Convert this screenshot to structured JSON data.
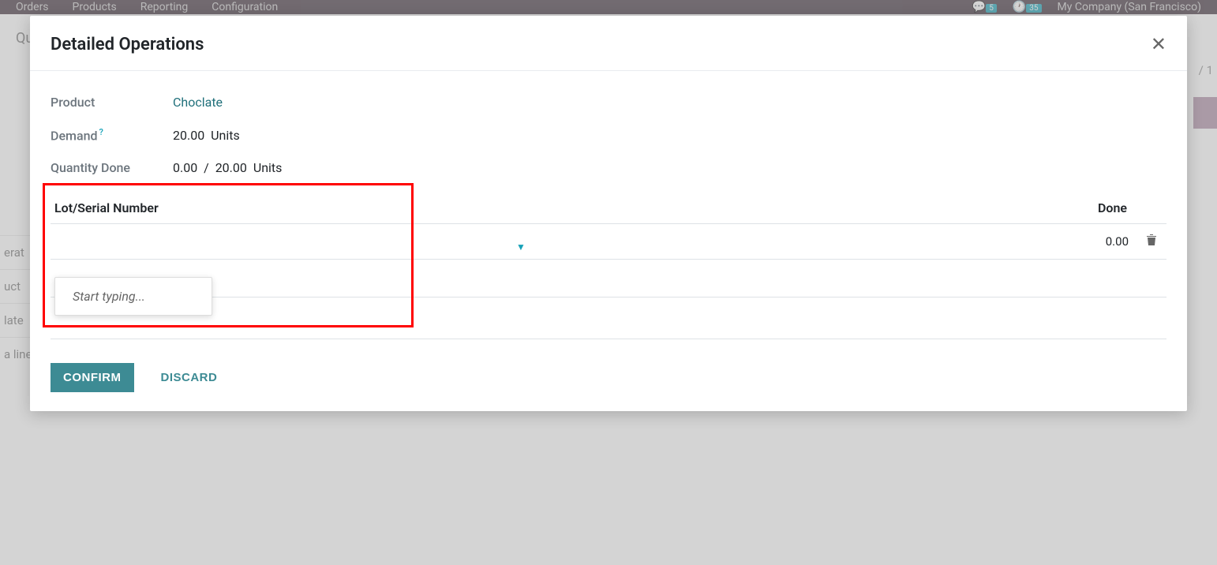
{
  "topbar": {
    "menu": [
      "Orders",
      "Products",
      "Reporting",
      "Configuration"
    ],
    "chat_count": "5",
    "activity_count": "35",
    "company": "My Company (San Francisco)"
  },
  "background": {
    "pager": "/ 1",
    "sidebar": [
      "erat",
      "uct",
      "late",
      "a line"
    ]
  },
  "modal": {
    "title": "Detailed Operations",
    "fields": {
      "product_label": "Product",
      "product_value": "Choclate",
      "demand_label": "Demand",
      "demand_help": "?",
      "demand_value": "20.00",
      "demand_unit": "Units",
      "qty_done_label": "Quantity Done",
      "qty_done_value": "0.00",
      "qty_done_sep": "/",
      "qty_done_total": "20.00",
      "qty_done_unit": "Units"
    },
    "table": {
      "col_lot": "Lot/Serial Number",
      "col_done": "Done",
      "row_done": "0.00",
      "dropdown_placeholder": "Start typing..."
    },
    "buttons": {
      "confirm": "CONFIRM",
      "discard": "DISCARD"
    }
  }
}
